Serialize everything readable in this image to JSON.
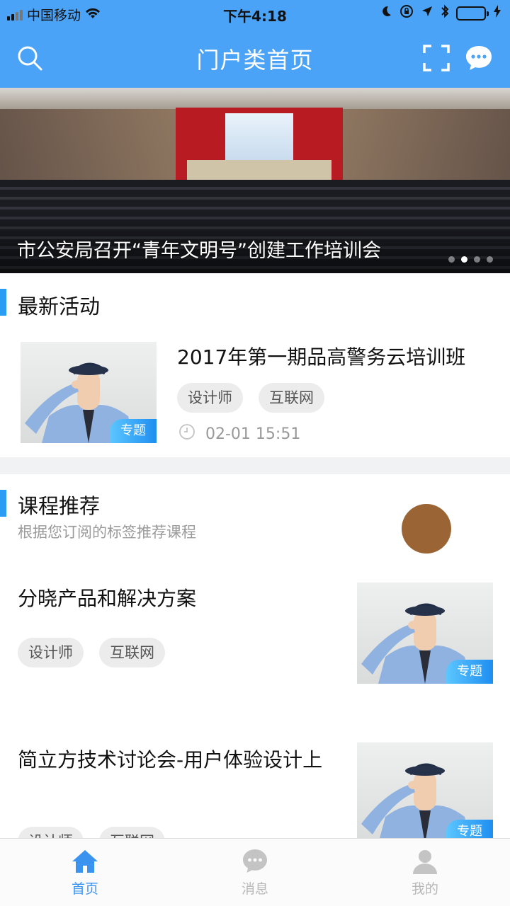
{
  "status_bar": {
    "carrier": "中国移动",
    "time": "下午4:18"
  },
  "nav": {
    "title": "门户类首页",
    "icons": [
      "search-icon",
      "scan-icon",
      "message-icon"
    ],
    "bg_color": "#4aa3f7"
  },
  "banner": {
    "caption": "市公安局召开“青年文明号”创建工作培训会",
    "slide_count": 4,
    "active_slide": 2
  },
  "latest": {
    "title": "最新活动",
    "item": {
      "title": "2017年第一期品高警务云培训班",
      "tags": [
        "设计师",
        "互联网"
      ],
      "badge": "专题",
      "time": "02-01 15:51"
    }
  },
  "courses": {
    "title": "课程推荐",
    "subtitle": "根据您订阅的标签推荐课程",
    "items": [
      {
        "title": "分晓产品和解决方案",
        "tags": [
          "设计师",
          "互联网"
        ],
        "badge": "专题"
      },
      {
        "title": "简立方技术讨论会-用户体验设计上",
        "tags": [
          "设计师",
          "互联网"
        ],
        "badge": "专题"
      }
    ]
  },
  "tabbar": {
    "tabs": [
      {
        "label": "首页",
        "icon": "home-icon",
        "active": true
      },
      {
        "label": "消息",
        "icon": "chat-icon",
        "active": false
      },
      {
        "label": "我的",
        "icon": "user-icon",
        "active": false
      }
    ],
    "active_color": "#3b93f0"
  }
}
